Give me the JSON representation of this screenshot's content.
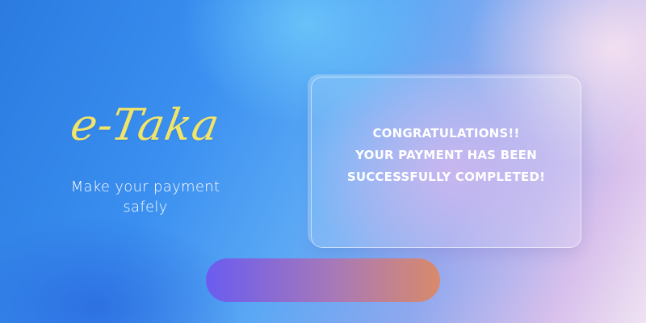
{
  "brand": {
    "logo_text": "e-Taka",
    "tagline_line1": "Make your payment",
    "tagline_line2": "safely"
  },
  "message": {
    "line1": "CONGRATULATIONS!!",
    "line2": "YOUR PAYMENT HAS BEEN",
    "line3": "SUCCESSFULLY COMPLETED!"
  },
  "button": {
    "label": ""
  },
  "colors": {
    "logo": "#f1e46a",
    "button_start": "#6a5cf0",
    "button_end": "#d98a6a",
    "text": "#ffffff"
  }
}
